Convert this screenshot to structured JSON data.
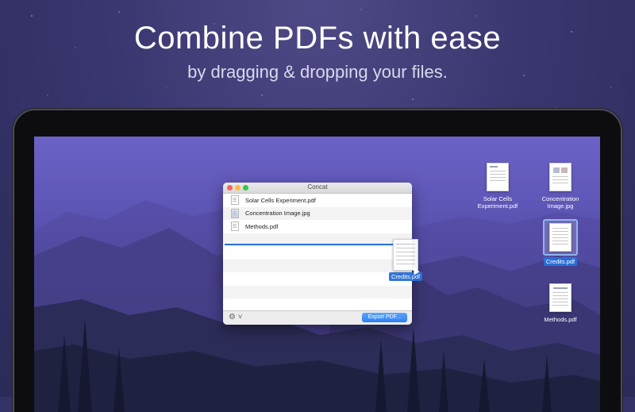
{
  "headline": "Combine PDFs with ease",
  "subline": "by dragging & dropping your files.",
  "window": {
    "title": "Concat",
    "files": [
      {
        "name": "Solar Cells Experiment.pdf",
        "icon": "pdf-file-icon"
      },
      {
        "name": "Concentration Image.jpg",
        "icon": "image-file-icon"
      },
      {
        "name": "Methods.pdf",
        "icon": "pdf-file-icon"
      }
    ],
    "gear_icon": "gear-icon",
    "export_label": "Export PDF..."
  },
  "dragging": {
    "label": "Credits.pdf"
  },
  "desktop": {
    "solar_line1": "Solar Cells",
    "solar_line2": "Experiment.pdf",
    "conc_line1": "Concentration",
    "conc_line2": "Image.jpg",
    "credits": "Credits.pdf",
    "methods": "Methods.pdf"
  },
  "colors": {
    "accent": "#2a6fd6",
    "background": "#3a3770"
  }
}
